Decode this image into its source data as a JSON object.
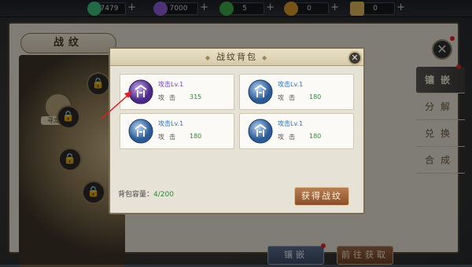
{
  "resources": [
    {
      "value": "7479",
      "icon": "jade-icon",
      "color": "#3fbf7f"
    },
    {
      "value": "7000",
      "icon": "crystal-icon",
      "color": "#8e5cd8"
    },
    {
      "value": "5",
      "icon": "leaf-icon",
      "color": "#3faa4c"
    },
    {
      "value": "0",
      "icon": "coin-bag-icon",
      "color": "#d79a2c"
    },
    {
      "value": "0",
      "icon": "scroll-icon",
      "color": "#e1b857"
    }
  ],
  "outer_window": {
    "title": "战纹",
    "rune_caption": "寻龙纹章",
    "tabs": [
      "镶嵌",
      "分解",
      "兑换",
      "合成"
    ],
    "bottom_buttons": [
      "镶嵌",
      "前往获取"
    ]
  },
  "modal": {
    "title": "战纹背包",
    "cards": [
      {
        "name": "攻击Lv.1",
        "attr": "攻击",
        "value": "315",
        "name_color": "#7a3fb8"
      },
      {
        "name": "攻击Lv.1",
        "attr": "攻击",
        "value": "180",
        "name_color": "#2f6fb5"
      },
      {
        "name": "攻击Lv.1",
        "attr": "攻击",
        "value": "180",
        "name_color": "#2f6fb5"
      },
      {
        "name": "攻击Lv.1",
        "attr": "攻击",
        "value": "180",
        "name_color": "#2f6fb5"
      }
    ],
    "capacity_label": "背包容量：",
    "capacity_value": "4/200",
    "get_button": "获得战纹"
  }
}
